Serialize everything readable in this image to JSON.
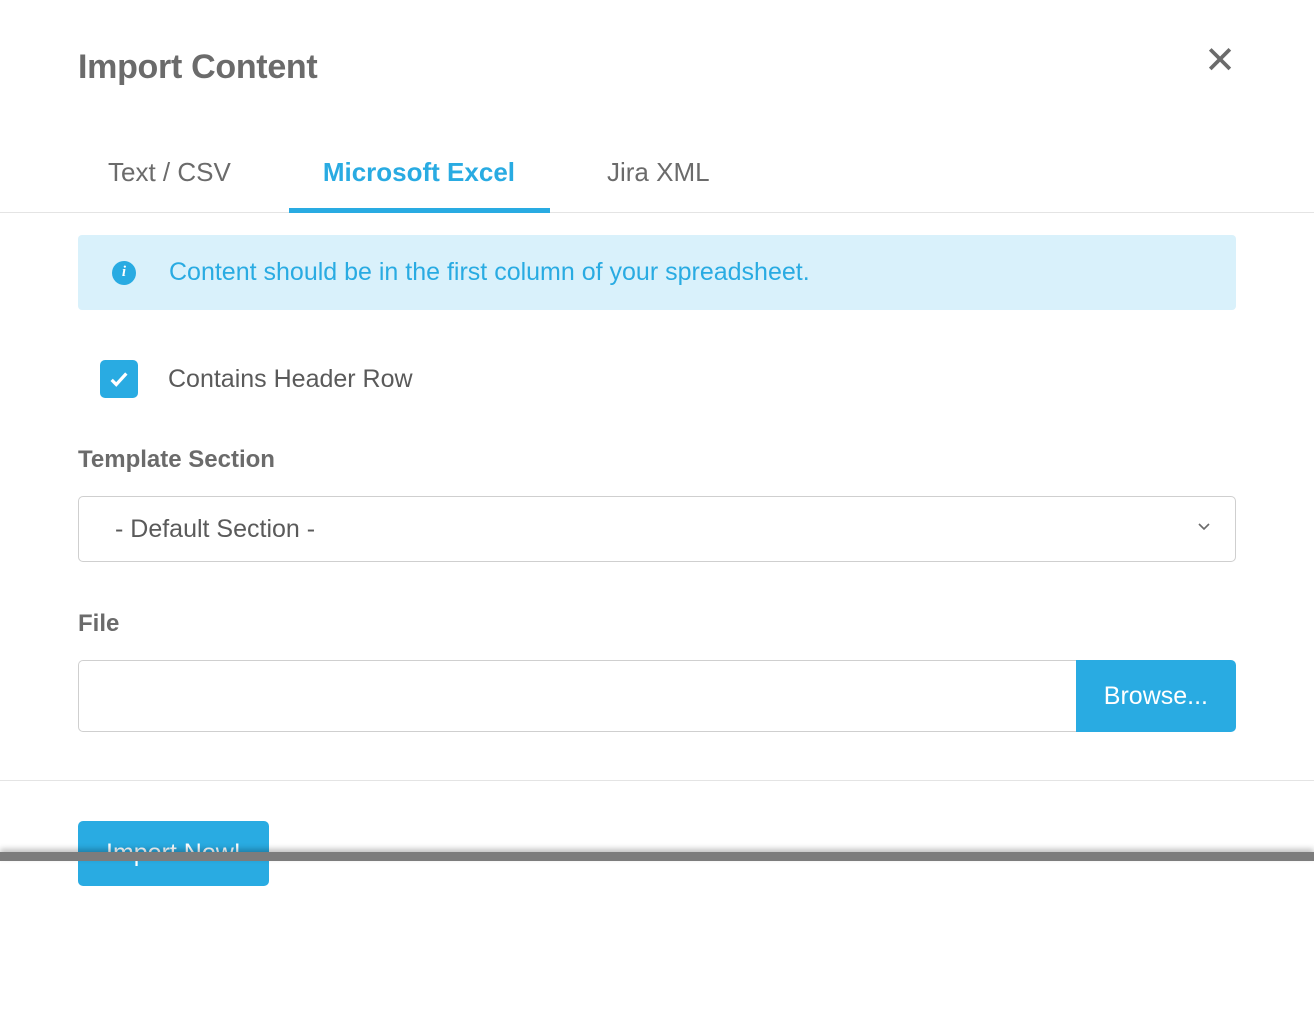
{
  "dialog": {
    "title": "Import Content"
  },
  "tabs": [
    {
      "label": "Text / CSV",
      "active": false
    },
    {
      "label": "Microsoft Excel",
      "active": true
    },
    {
      "label": "Jira XML",
      "active": false
    }
  ],
  "infoBanner": {
    "message": "Content should be in the first column of your spreadsheet."
  },
  "headerRowCheckbox": {
    "label": "Contains Header Row",
    "checked": true
  },
  "templateSection": {
    "label": "Template Section",
    "selected": "- Default Section -"
  },
  "fileField": {
    "label": "File",
    "value": "",
    "browseLabel": "Browse..."
  },
  "importButton": {
    "label": "Import Now!"
  },
  "colors": {
    "accent": "#29abe2",
    "bannerBg": "#d9f1fb",
    "textMuted": "#6b6b6b"
  }
}
